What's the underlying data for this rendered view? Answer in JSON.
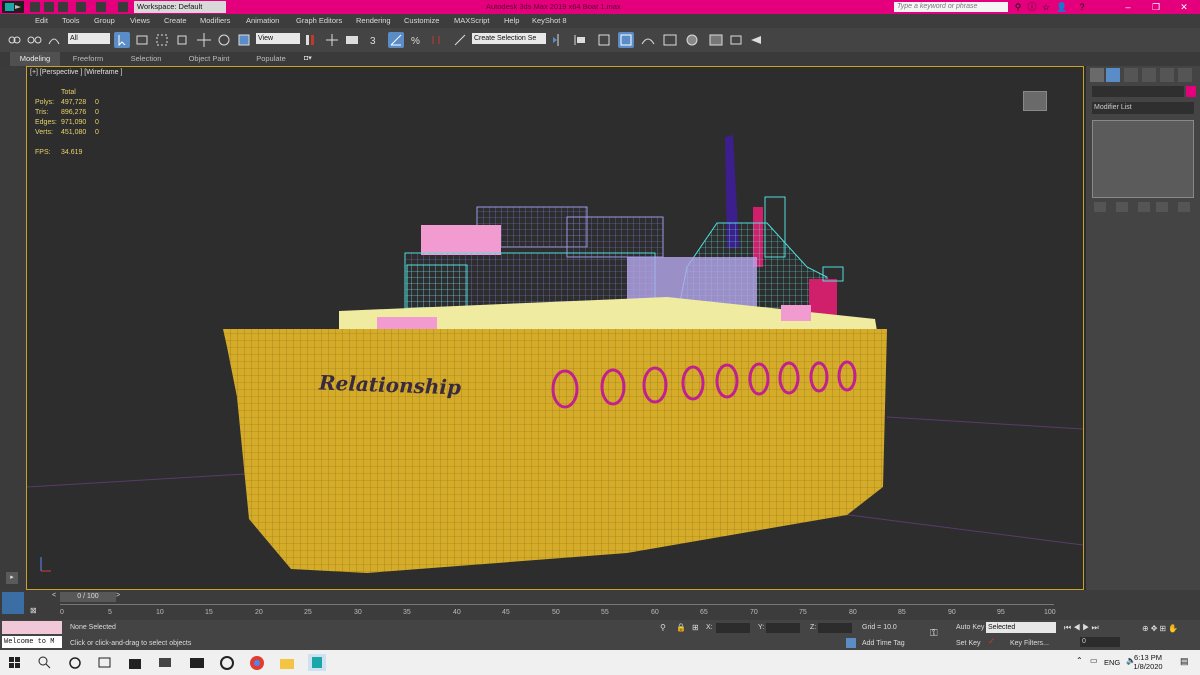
{
  "titlebar": {
    "workspace_label": "Workspace: Default",
    "title": "Autodesk 3ds Max 2019 x64    Boat 1.max",
    "search_placeholder": "Type a keyword or phrase"
  },
  "menu": [
    "Edit",
    "Tools",
    "Group",
    "Views",
    "Create",
    "Modifiers",
    "Animation",
    "Graph Editors",
    "Rendering",
    "Customize",
    "MAXScript",
    "Help",
    "KeyShot 8"
  ],
  "toolbar": {
    "filter_value": "All",
    "refcoord_value": "View",
    "selection_set_value": "Create Selection Se"
  },
  "ribbon_tabs": [
    "Modeling",
    "Freeform",
    "Selection",
    "Object Paint",
    "Populate"
  ],
  "viewport": {
    "label": "[+] [Perspective ] [Wireframe ]",
    "stats": {
      "header": "Total",
      "rows": [
        {
          "label": "Polys:",
          "total": "497,728",
          "sel": "0"
        },
        {
          "label": "Tris:",
          "total": "896,276",
          "sel": "0"
        },
        {
          "label": "Edges:",
          "total": "971,090",
          "sel": "0"
        },
        {
          "label": "Verts:",
          "total": "451,080",
          "sel": "0"
        }
      ],
      "fps_label": "FPS:",
      "fps_value": "34.619"
    },
    "hull_text": "Relationship"
  },
  "command_panel": {
    "modifier_list": "Modifier List"
  },
  "timeline": {
    "slider_label": "0 / 100",
    "ticks": [
      "0",
      "5",
      "10",
      "15",
      "20",
      "25",
      "30",
      "35",
      "40",
      "45",
      "50",
      "55",
      "60",
      "65",
      "70",
      "75",
      "80",
      "85",
      "90",
      "95",
      "100"
    ]
  },
  "status": {
    "maxscript": "Welcome to M",
    "selection": "None Selected",
    "prompt": "Click or click-and-drag to select objects",
    "x_label": "X:",
    "y_label": "Y:",
    "z_label": "Z:",
    "grid": "Grid = 10.0",
    "add_time_tag": "Add Time Tag",
    "auto_key": "Auto Key",
    "set_key": "Set Key",
    "selected_value": "Selected",
    "key_filters": "Key Filters...",
    "frame_value": "0"
  },
  "taskbar": {
    "lang": "ENG",
    "time": "6:13 PM",
    "date": "1/8/2020"
  },
  "colors": {
    "titlebar": "#e4007c",
    "hull": "#d4ac2a",
    "viewport_border": "#c9a227"
  }
}
